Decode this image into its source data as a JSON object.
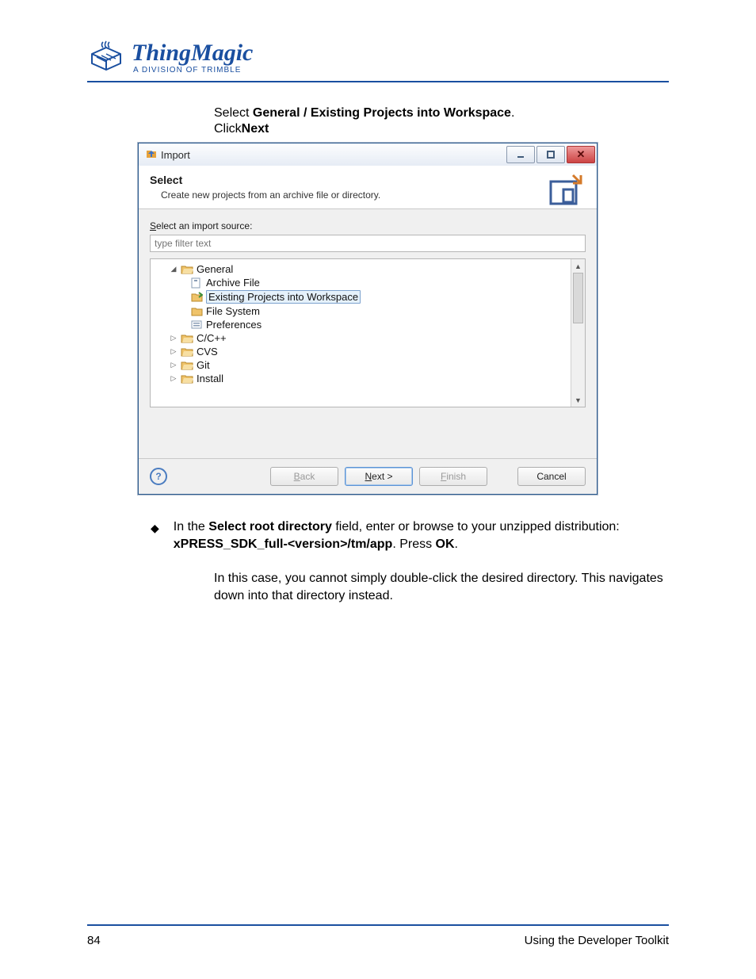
{
  "brand": {
    "name": "ThingMagic",
    "tagline": "A DIVISION OF TRIMBLE"
  },
  "intro": {
    "line1_pre": "Select ",
    "line1_bold": "General / Existing Projects into Workspace",
    "line1_post": ".",
    "line2_pre": "Click",
    "line2_bold": "Next"
  },
  "dlg": {
    "title": "Import",
    "header_title": "Select",
    "header_sub": "Create new projects from an archive file or directory.",
    "label": "Select an import source:",
    "filter_placeholder": "type filter text",
    "buttons": {
      "back": "< Back",
      "next": "Next >",
      "finish": "Finish",
      "cancel": "Cancel"
    },
    "tree": {
      "general": "General",
      "archive": "Archive File",
      "existing": "Existing Projects into Workspace",
      "filesystem": "File System",
      "preferences": "Preferences",
      "cpp": "C/C++",
      "cvs": "CVS",
      "git": "Git",
      "install": "Install"
    }
  },
  "step": {
    "pre": "In the ",
    "b1": "Select root directory",
    "mid": " field, enter or browse to your unzipped distribution: ",
    "b2": "xPRESS_SDK_full-<version>/tm/app",
    "mid2": ".  Press ",
    "b3": "OK",
    "post": "."
  },
  "note": "In this case, you cannot simply double-click the desired directory.  This navigates down into that directory instead.",
  "footer": {
    "page": "84",
    "label": "Using the Developer Toolkit"
  }
}
